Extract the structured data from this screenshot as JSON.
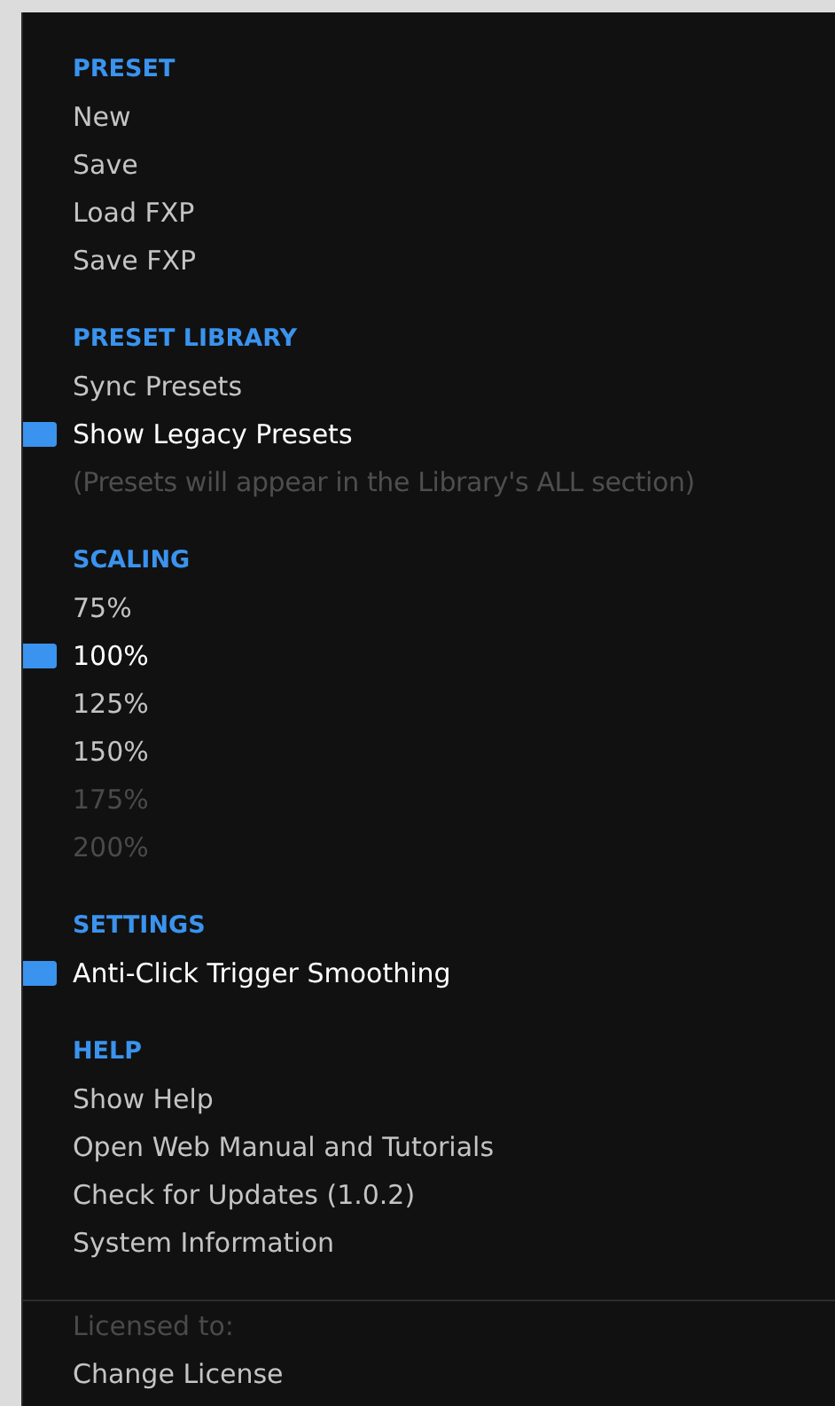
{
  "sections": [
    {
      "heading": "PRESET",
      "items": [
        {
          "kind": "item",
          "label": "New",
          "checked": false,
          "disabled": false
        },
        {
          "kind": "item",
          "label": "Save",
          "checked": false,
          "disabled": false
        },
        {
          "kind": "item",
          "label": "Load FXP",
          "checked": false,
          "disabled": false
        },
        {
          "kind": "item",
          "label": "Save FXP",
          "checked": false,
          "disabled": false
        }
      ]
    },
    {
      "heading": "PRESET LIBRARY",
      "items": [
        {
          "kind": "item",
          "label": "Sync Presets",
          "checked": false,
          "disabled": false
        },
        {
          "kind": "item",
          "label": "Show Legacy Presets",
          "checked": true,
          "disabled": false
        },
        {
          "kind": "note",
          "label": "(Presets will appear in the Library's ALL section)"
        }
      ]
    },
    {
      "heading": "SCALING",
      "items": [
        {
          "kind": "item",
          "label": "75%",
          "checked": false,
          "disabled": false
        },
        {
          "kind": "item",
          "label": "100%",
          "checked": true,
          "disabled": false
        },
        {
          "kind": "item",
          "label": "125%",
          "checked": false,
          "disabled": false
        },
        {
          "kind": "item",
          "label": "150%",
          "checked": false,
          "disabled": false
        },
        {
          "kind": "item",
          "label": "175%",
          "checked": false,
          "disabled": true
        },
        {
          "kind": "item",
          "label": "200%",
          "checked": false,
          "disabled": true
        }
      ]
    },
    {
      "heading": "SETTINGS",
      "items": [
        {
          "kind": "item",
          "label": "Anti-Click Trigger Smoothing",
          "checked": true,
          "disabled": false
        }
      ]
    },
    {
      "heading": "HELP",
      "items": [
        {
          "kind": "item",
          "label": "Show Help",
          "checked": false,
          "disabled": false
        },
        {
          "kind": "item",
          "label": "Open Web Manual and Tutorials",
          "checked": false,
          "disabled": false
        },
        {
          "kind": "item",
          "label": "Check for Updates (1.0.2)",
          "checked": false,
          "disabled": false
        },
        {
          "kind": "item",
          "label": "System Information",
          "checked": false,
          "disabled": false
        }
      ]
    }
  ],
  "footer": {
    "license_label": "Licensed to:",
    "change_license": "Change License"
  }
}
